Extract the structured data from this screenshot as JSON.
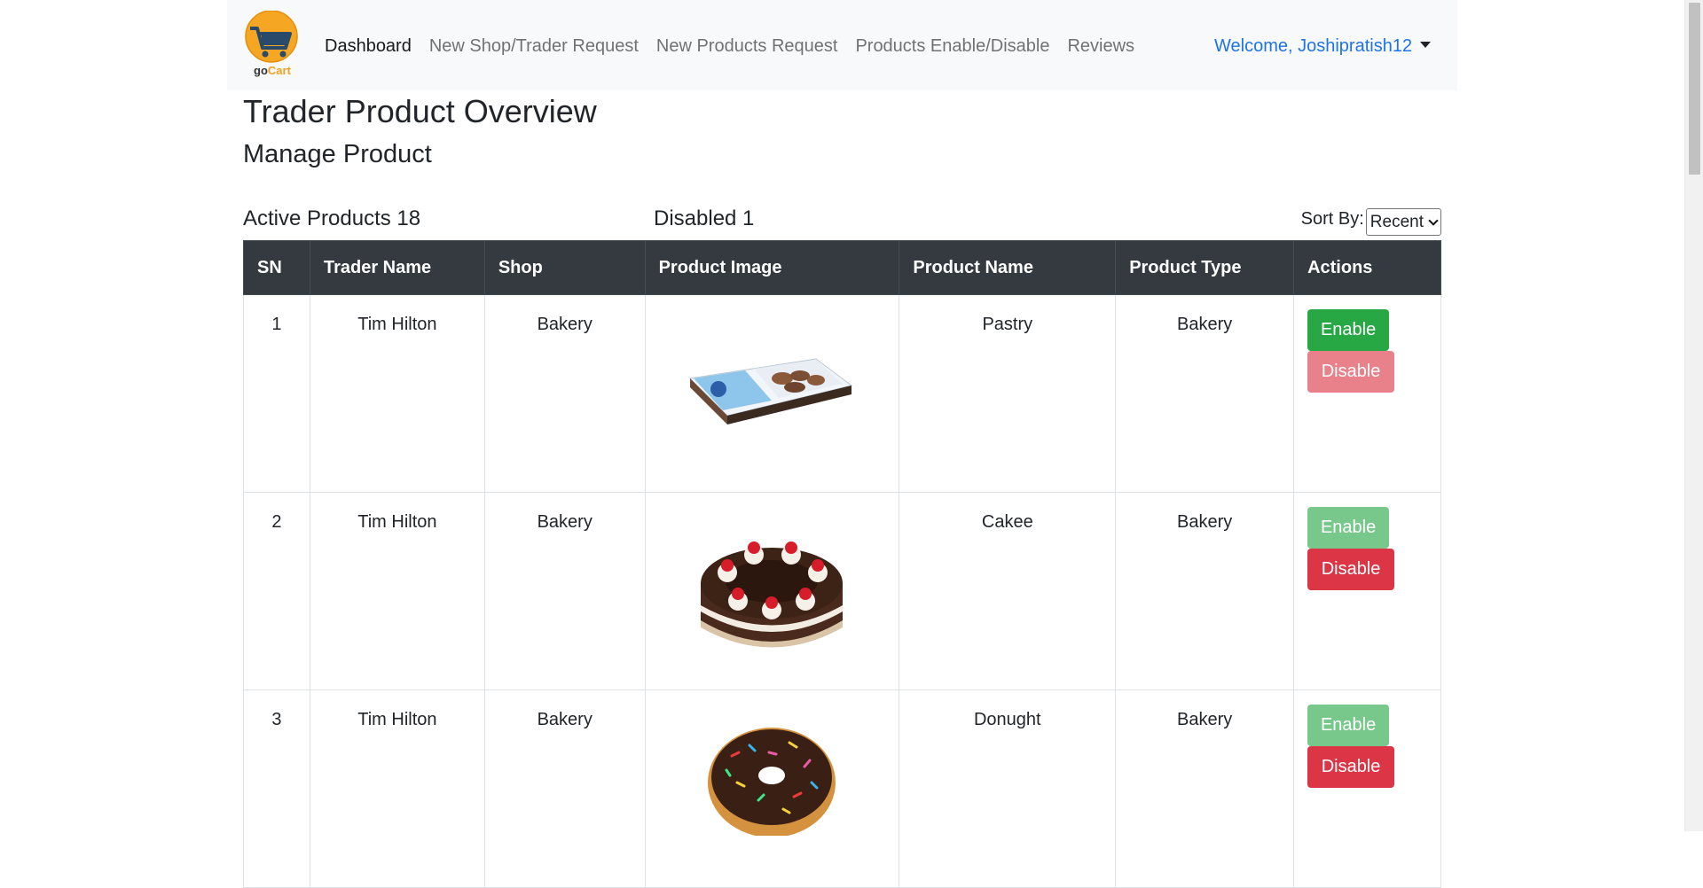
{
  "brand": {
    "logo_text_a": "go",
    "logo_text_b": "Cart"
  },
  "nav": {
    "links": [
      {
        "label": "Dashboard",
        "active": true
      },
      {
        "label": "New Shop/Trader Request"
      },
      {
        "label": "New Products Request"
      },
      {
        "label": "Products Enable/Disable"
      },
      {
        "label": "Reviews"
      }
    ],
    "welcome": "Welcome, Joshipratish12"
  },
  "page": {
    "title": "Trader Product Overview",
    "subtitle": "Manage Product",
    "active_products": "Active Products 18",
    "disabled": "Disabled 1",
    "sort_label": "Sort By:",
    "sort_value": "Recent"
  },
  "table": {
    "headers": [
      "SN",
      "Trader Name",
      "Shop",
      "Product Image",
      "Product Name",
      "Product Type",
      "Actions"
    ],
    "enable_label": "Enable",
    "disable_label": "Disable",
    "rows": [
      {
        "sn": "1",
        "trader": "Tim Hilton",
        "shop": "Bakery",
        "image": "pastry-image",
        "name": "Pastry",
        "type": "Bakery",
        "status": "disabled"
      },
      {
        "sn": "2",
        "trader": "Tim Hilton",
        "shop": "Bakery",
        "image": "cake-image",
        "name": "Cakee",
        "type": "Bakery",
        "status": "enabled"
      },
      {
        "sn": "3",
        "trader": "Tim Hilton",
        "shop": "Bakery",
        "image": "donut-image",
        "name": "Donught",
        "type": "Bakery",
        "status": "enabled"
      }
    ]
  },
  "colors": {
    "enable": "#28a745",
    "disable": "#dc3545",
    "header_bg": "#343a40",
    "link": "#1e73e8"
  }
}
